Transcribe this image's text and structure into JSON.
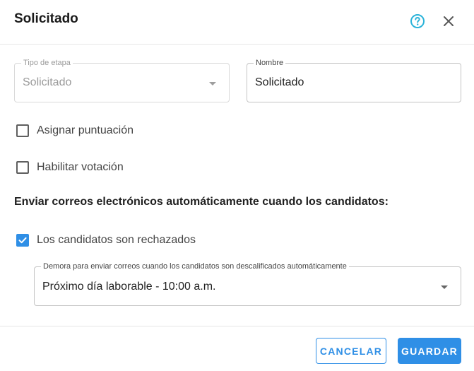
{
  "dialog": {
    "title": "Solicitado",
    "icons": {
      "help": "help-circle-icon",
      "close": "close-icon"
    }
  },
  "fields": {
    "stage_type": {
      "legend": "Tipo de etapa",
      "value": "Solicitado",
      "disabled": true
    },
    "name": {
      "legend": "Nombre",
      "value": "Solicitado"
    },
    "delay": {
      "legend": "Demora para enviar correos cuando los candidatos son descalificados automáticamente",
      "value": "Próximo día laborable - 10:00 a.m."
    }
  },
  "options": {
    "assign_score": {
      "label": "Asignar puntuación",
      "checked": false
    },
    "enable_voting": {
      "label": "Habilitar votación",
      "checked": false
    }
  },
  "emails": {
    "section_title": "Enviar correos electrónicos automáticamente cuando los candidatos:",
    "rejected": {
      "label": "Los candidatos son rechazados",
      "checked": true
    }
  },
  "footer": {
    "cancel_label": "CANCELAR",
    "save_label": "GUARDAR"
  },
  "colors": {
    "accent": "#2f8fe6",
    "help_icon": "#2bb3d9"
  }
}
